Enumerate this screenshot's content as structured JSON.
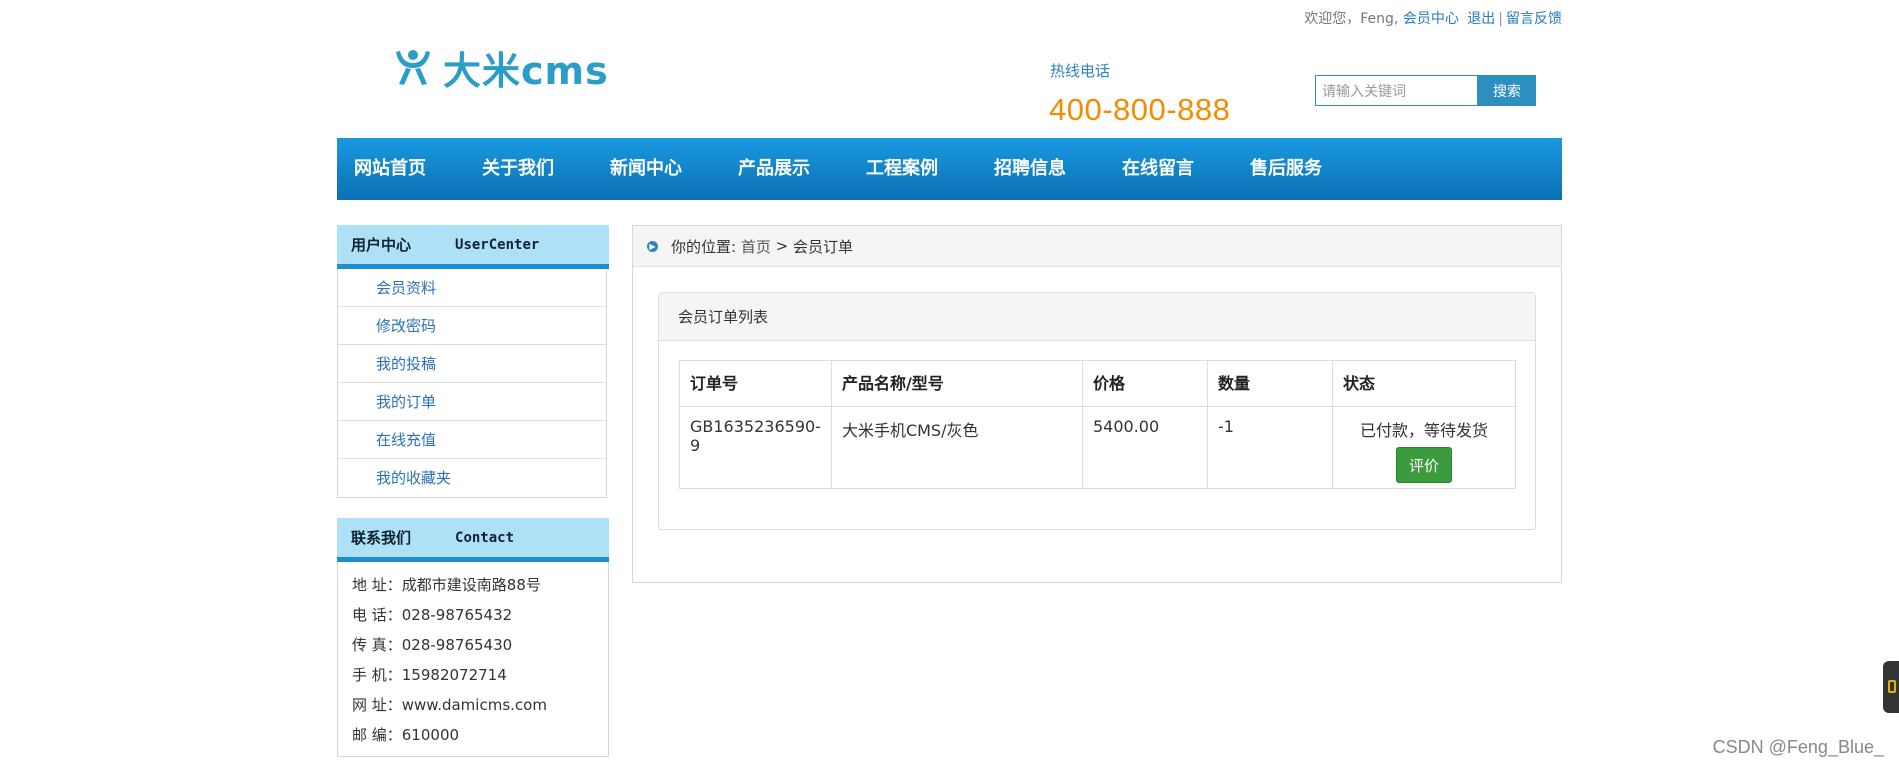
{
  "topbar": {
    "welcome": "欢迎您，Feng,",
    "member_center": "会员中心",
    "logout": "退出",
    "separator": "|",
    "feedback": "留言反馈"
  },
  "logo": {
    "icon": "damicms-logo-icon",
    "text": "大米cms"
  },
  "hotline": {
    "label": "热线电话",
    "number": "400-800-888"
  },
  "search": {
    "placeholder": "请输入关键词",
    "button": "搜索"
  },
  "nav": [
    "网站首页",
    "关于我们",
    "新闻中心",
    "产品展示",
    "工程案例",
    "招聘信息",
    "在线留言",
    "售后服务"
  ],
  "sidebar": {
    "user_center": {
      "title_cn": "用户中心",
      "title_en": "UserCenter",
      "items": [
        "会员资料",
        "修改密码",
        "我的投稿",
        "我的订单",
        "在线充值",
        "我的收藏夹"
      ]
    },
    "contact": {
      "title_cn": "联系我们",
      "title_en": "Contact",
      "lines": [
        "地 址：成都市建设南路88号",
        "电 话：028-98765432",
        "传 真：028-98765430",
        "手 机：15982072714",
        "网 址：www.damicms.com",
        "邮 编：610000"
      ]
    }
  },
  "breadcrumb": {
    "label": "你的位置:",
    "home": "首页",
    "separator": ">",
    "current": "会员订单"
  },
  "orders": {
    "title": "会员订单列表",
    "headers": [
      "订单号",
      "产品名称/型号",
      "价格",
      "数量",
      "状态"
    ],
    "rows": [
      {
        "order_no": "GB1635236590-9",
        "product": "大米手机CMS/灰色",
        "price": "5400.00",
        "qty": "-1",
        "status": "已付款，等待发货",
        "action": "评价"
      }
    ]
  },
  "watermark": "CSDN @Feng_Blue_",
  "colors": {
    "nav": "#0b7dc4",
    "accent": "#f28c00",
    "link": "#2a73b7",
    "button_green": "#3c9b3c"
  }
}
